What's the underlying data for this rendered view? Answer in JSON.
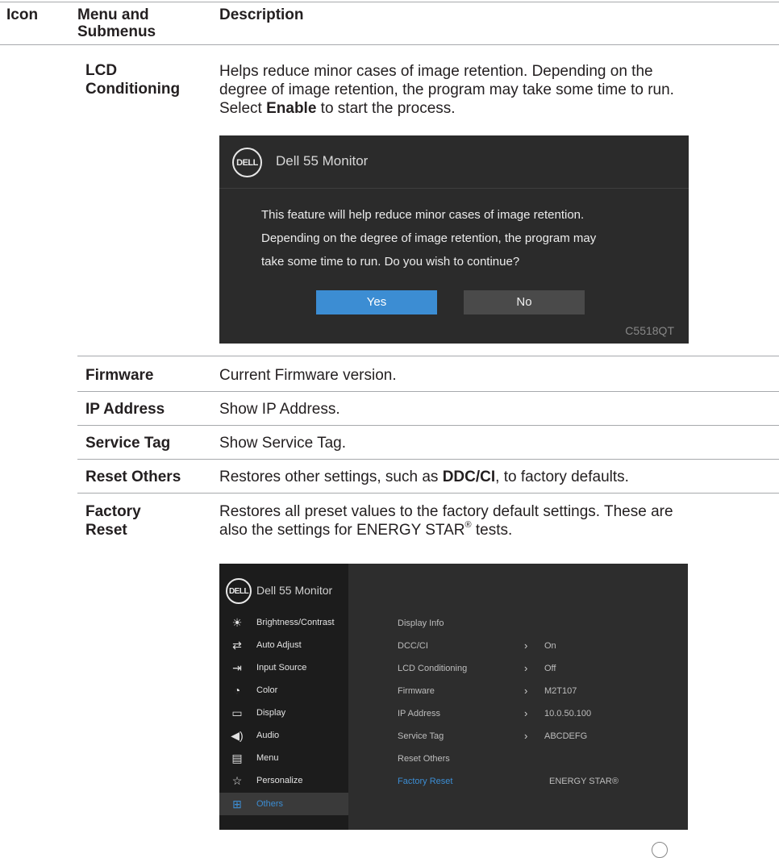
{
  "header": {
    "icon": "Icon",
    "menu_line1": "Menu and",
    "menu_line2": "Submenus",
    "description": "Description"
  },
  "lcd": {
    "name_line1": "LCD",
    "name_line2": "Conditioning",
    "desc_line1": "Helps reduce minor cases of image retention. Depending on the",
    "desc_line2": "degree of image retention, the program may take some time to run.",
    "desc_line3_pre": "Select ",
    "desc_line3_bold": "Enable",
    "desc_line3_post": " to start the process."
  },
  "dialog": {
    "logo": "DELL",
    "title": "Dell 55 Monitor",
    "message_line1": "This feature will help reduce minor cases of image retention.",
    "message_line2": "Depending on the degree of image retention, the program may",
    "message_line3": "take some time to run. Do you wish to continue?",
    "yes": "Yes",
    "no": "No",
    "model": "C5518QT"
  },
  "rows": {
    "firmware": {
      "name": "Firmware",
      "desc": "Current Firmware version."
    },
    "ip": {
      "name": "IP Address",
      "desc": "Show IP Address."
    },
    "service": {
      "name": "Service Tag",
      "desc": "Show Service Tag."
    },
    "reset_others": {
      "name": "Reset Others",
      "desc_pre": "Restores other settings, such as ",
      "desc_bold": "DDC/CI",
      "desc_post": ", to factory defaults."
    },
    "factory": {
      "name_line1": "Factory",
      "name_line2": "Reset",
      "desc_line1": "Restores all preset values to the factory default settings. These are",
      "desc_line2_pre": "also the settings for ENERGY STAR",
      "desc_line2_sup": "®",
      "desc_line2_post": " tests."
    }
  },
  "osd": {
    "logo": "DELL",
    "title": "Dell 55 Monitor",
    "menu": [
      {
        "label": "Brightness/Contrast",
        "icon": "brightness-icon"
      },
      {
        "label": "Auto Adjust",
        "icon": "auto-adjust-icon"
      },
      {
        "label": "Input Source",
        "icon": "input-source-icon"
      },
      {
        "label": "Color",
        "icon": "color-icon"
      },
      {
        "label": "Display",
        "icon": "display-icon"
      },
      {
        "label": "Audio",
        "icon": "audio-icon"
      },
      {
        "label": "Menu",
        "icon": "menu-icon"
      },
      {
        "label": "Personalize",
        "icon": "star-icon"
      },
      {
        "label": "Others",
        "icon": "others-icon"
      }
    ],
    "active_menu": "Others",
    "items": [
      {
        "label": "Display Info",
        "value": ""
      },
      {
        "label": "DCC/CI",
        "value": "On"
      },
      {
        "label": "LCD Conditioning",
        "value": "Off"
      },
      {
        "label": "Firmware",
        "value": "M2T107"
      },
      {
        "label": "IP Address",
        "value": "10.0.50.100"
      },
      {
        "label": "Service Tag",
        "value": "ABCDEFG"
      },
      {
        "label": "Reset Others",
        "value": ""
      },
      {
        "label": "Factory Reset",
        "value": "ENERGY STAR®"
      }
    ],
    "selected_item": "Factory Reset",
    "accent": "#3c8dd3"
  }
}
